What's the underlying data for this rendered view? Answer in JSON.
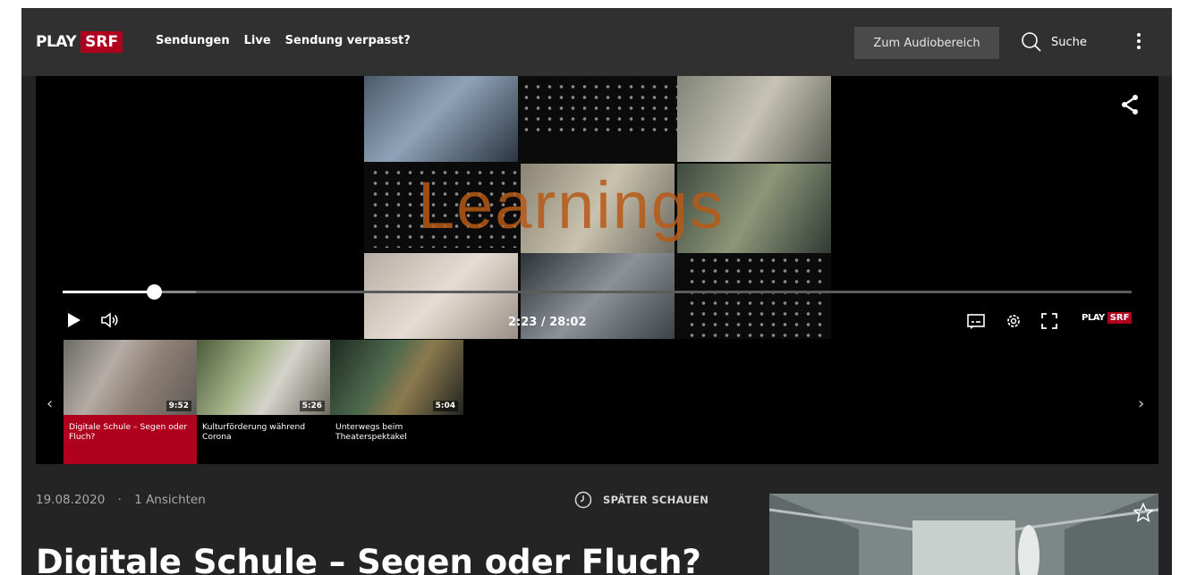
{
  "header": {
    "logo_play": "PLAY",
    "logo_srf": "SRF",
    "nav": [
      "Sendungen",
      "Live",
      "Sendung verpasst?"
    ],
    "audio_button": "Zum Audiobereich",
    "search_label": "Suche"
  },
  "player": {
    "overlay_text": "Learnings",
    "time": "2:23 / 28:02",
    "progress": 0.085,
    "logo_play": "PLAY",
    "logo_srf": "SRF"
  },
  "playlist": [
    {
      "title": "Digitale Schule – Segen oder Fluch?",
      "duration": "9:52",
      "active": true
    },
    {
      "title": "Kulturförderung während Corona",
      "duration": "5:26",
      "active": false
    },
    {
      "title": "Unterwegs beim Theaterspektakel",
      "duration": "5:04",
      "active": false
    }
  ],
  "meta": {
    "date": "19.08.2020",
    "separator": "·",
    "views": "1 Ansichten",
    "watch_later": "SPÄTER SCHAUEN"
  },
  "title": "Digitale Schule – Segen oder Fluch?",
  "colors": {
    "brand": "#af001e",
    "background": "#242424",
    "header": "#303030"
  }
}
